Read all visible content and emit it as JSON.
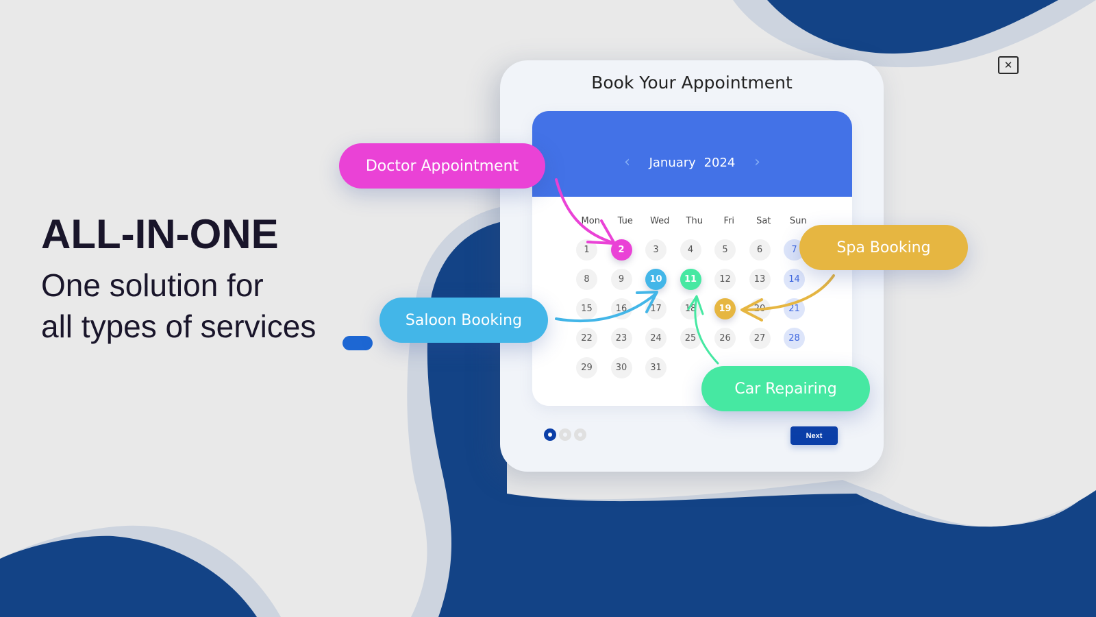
{
  "hero": {
    "title": "ALL-IN-ONE",
    "subtitle_line1": "One solution for",
    "subtitle_line2": "all types of services"
  },
  "close_button": {
    "icon": "close-icon",
    "glyph": "✕"
  },
  "card": {
    "title": "Book Your Appointment",
    "calendar": {
      "month": "January",
      "year": "2024",
      "prev_icon": "‹",
      "next_icon": "›",
      "weekdays": [
        "Mon",
        "Tue",
        "Wed",
        "Thu",
        "Fri",
        "Sat",
        "Sun"
      ],
      "weeks": [
        [
          "1",
          "2",
          "3",
          "4",
          "5",
          "6",
          "7"
        ],
        [
          "8",
          "9",
          "10",
          "11",
          "12",
          "13",
          "14"
        ],
        [
          "15",
          "16",
          "17",
          "18",
          "19",
          "20",
          "21"
        ],
        [
          "22",
          "23",
          "24",
          "25",
          "26",
          "27",
          "28"
        ],
        [
          "29",
          "30",
          "31",
          "",
          "",
          "",
          ""
        ]
      ],
      "highlighted_days": [
        {
          "day": "2",
          "service": "Doctor Appointment",
          "color": "#ea42d6"
        },
        {
          "day": "10",
          "service": "Saloon Booking",
          "color": "#43b6e8"
        },
        {
          "day": "11",
          "service": "Car Repairing",
          "color": "#46e8a2"
        },
        {
          "day": "19",
          "service": "Spa Booking",
          "color": "#e6b641"
        }
      ]
    },
    "pagination": {
      "total": 3,
      "active": 1
    },
    "next_label": "Next"
  },
  "services": [
    {
      "label": "Doctor Appointment",
      "color": "#ea42d6"
    },
    {
      "label": "Saloon Booking",
      "color": "#43b6e8"
    },
    {
      "label": "Spa Booking",
      "color": "#e6b641"
    },
    {
      "label": "Car Repairing",
      "color": "#46e8a2"
    }
  ],
  "colors": {
    "background": "#e9e9e9",
    "navy": "#134386",
    "navy_halo": "#cdd4df",
    "calendar_header": "#4372e7",
    "next_button": "#0b3fa8",
    "sunday_tint": "#dde5fa",
    "sunday_text": "#3f67df"
  }
}
